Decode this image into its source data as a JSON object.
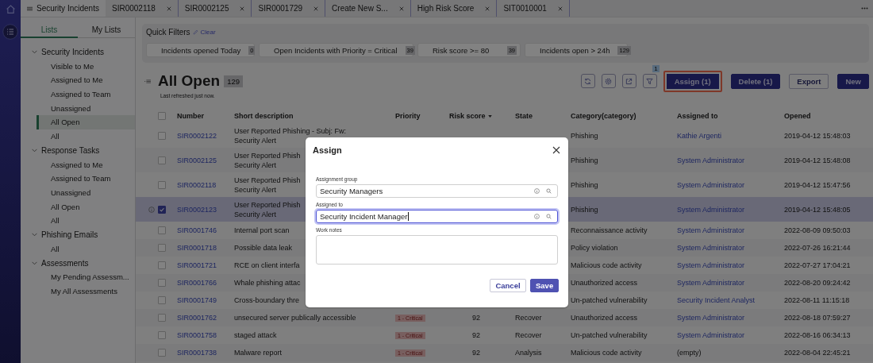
{
  "tabs": [
    {
      "label": "Security Incidents",
      "selected": true,
      "closable": false
    },
    {
      "label": "SIR0002118",
      "selected": false,
      "closable": true
    },
    {
      "label": "SIR0002125",
      "selected": false,
      "closable": true
    },
    {
      "label": "SIR0001729",
      "selected": false,
      "closable": true
    },
    {
      "label": "Create New S...",
      "selected": false,
      "closable": true
    },
    {
      "label": "High Risk Score",
      "selected": false,
      "closable": true
    },
    {
      "label": "SIT0010001",
      "selected": false,
      "closable": true
    }
  ],
  "list_tabs": [
    {
      "label": "Lists",
      "selected": true
    },
    {
      "label": "My Lists",
      "selected": false
    }
  ],
  "tree": [
    {
      "label": "Security Incidents",
      "expanded": true,
      "children": [
        {
          "label": "Visible to Me",
          "selected": false
        },
        {
          "label": "Assigned to Me",
          "selected": false
        },
        {
          "label": "Assigned to Team",
          "selected": false
        },
        {
          "label": "Unassigned",
          "selected": false
        },
        {
          "label": "All Open",
          "selected": true
        },
        {
          "label": "All",
          "selected": false
        }
      ]
    },
    {
      "label": "Response Tasks",
      "expanded": true,
      "children": [
        {
          "label": "Assigned to Me",
          "selected": false
        },
        {
          "label": "Assigned to Team",
          "selected": false
        },
        {
          "label": "Unassigned",
          "selected": false
        },
        {
          "label": "All Open",
          "selected": false
        },
        {
          "label": "All",
          "selected": false
        }
      ]
    },
    {
      "label": "Phishing Emails",
      "expanded": true,
      "children": [
        {
          "label": "All",
          "selected": false
        }
      ]
    },
    {
      "label": "Assessments",
      "expanded": true,
      "children": [
        {
          "label": "My Pending Assessm...",
          "selected": false
        },
        {
          "label": "My All Assessments",
          "selected": false
        }
      ]
    }
  ],
  "quick_filters": {
    "title": "Quick Filters",
    "clear": "Clear",
    "filters": [
      {
        "label": "Incidents opened Today",
        "count": "0"
      },
      {
        "label": "Open Incidents with Priority = Critical",
        "count": "39"
      },
      {
        "label": "Risk score >= 80",
        "count": "39"
      },
      {
        "label": "Incidents open > 24h",
        "count": "129"
      }
    ]
  },
  "list": {
    "title": "All Open",
    "count": "129",
    "refreshed": "Last refreshed just now.",
    "filter_count": "1",
    "buttons": [
      {
        "label": "Assign (1)",
        "kind": "primary",
        "highlighted": true
      },
      {
        "label": "Delete (1)",
        "kind": "primary",
        "highlighted": false
      },
      {
        "label": "Export",
        "kind": "secondary",
        "highlighted": false
      },
      {
        "label": "New",
        "kind": "primary",
        "highlighted": false
      }
    ]
  },
  "table": {
    "all_selected": false,
    "columns": [
      {
        "label": "Number",
        "sorted": false
      },
      {
        "label": "Short description",
        "sorted": false
      },
      {
        "label": "Priority",
        "sorted": false
      },
      {
        "label": "Risk score",
        "sorted": true
      },
      {
        "label": "State",
        "sorted": false
      },
      {
        "label": "Category(category)",
        "sorted": false
      },
      {
        "label": "Assigned to",
        "sorted": false
      },
      {
        "label": "Opened",
        "sorted": false
      }
    ],
    "rows": [
      {
        "selected": false,
        "number": "SIR0002122",
        "description": [
          "User Reported Phishing - Subj: Fw:",
          "Security Alert"
        ],
        "category": "Phishing",
        "assigned_to": "Kathie Argenti",
        "assigned_link": true,
        "opened": "2019-04-12 15:48:03"
      },
      {
        "selected": false,
        "number": "SIR0002125",
        "description": [
          "User Reported Phish",
          "Security Alert"
        ],
        "category": "Phishing",
        "assigned_to": "System Administrator",
        "assigned_link": true,
        "opened": "2019-04-12 15:48:08"
      },
      {
        "selected": false,
        "number": "SIR0002118",
        "description": [
          "User Reported Phish",
          "Security Alert"
        ],
        "category": "Phishing",
        "assigned_to": "System Administrator",
        "assigned_link": true,
        "opened": "2019-04-12 15:47:56"
      },
      {
        "selected": true,
        "number": "SIR0002123",
        "description": [
          "User Reported Phish",
          "Security Alert"
        ],
        "category": "Phishing",
        "assigned_to": "System Administrator",
        "assigned_link": true,
        "opened": "2019-04-12 15:48:05"
      },
      {
        "selected": false,
        "number": "SIR0001746",
        "description": [
          "Internal port scan"
        ],
        "category": "Reconnaissance activity",
        "assigned_to": "System Administrator",
        "assigned_link": true,
        "opened": "2022-08-09 09:50:03"
      },
      {
        "selected": false,
        "number": "SIR0001718",
        "description": [
          "Possible data leak"
        ],
        "category": "Policy violation",
        "assigned_to": "System Administrator",
        "assigned_link": true,
        "opened": "2022-07-26 16:21:44"
      },
      {
        "selected": false,
        "number": "SIR0001721",
        "description": [
          "RCE on client interfa"
        ],
        "category": "Malicious code activity",
        "assigned_to": "System Administrator",
        "assigned_link": true,
        "opened": "2022-07-27 17:04:21"
      },
      {
        "selected": false,
        "number": "SIR0001766",
        "description": [
          "Whale phishing attac"
        ],
        "category": "Unauthorized access",
        "assigned_to": "System Administrator",
        "assigned_link": true,
        "opened": "2022-08-20 09:24:42"
      },
      {
        "selected": false,
        "number": "SIR0001749",
        "description": [
          "Cross-boundary thre"
        ],
        "category": "Un-patched vulnerability",
        "assigned_to": "Security Incident Analyst",
        "assigned_link": true,
        "opened": "2022-08-11 11:15:18"
      },
      {
        "selected": false,
        "number": "SIR0001762",
        "description": [
          "unsecured server publically accessible"
        ],
        "priority": "1 - Critical",
        "risk_score": "92",
        "state": "Recover",
        "category": "Unauthorized access",
        "assigned_to": "System Administrator",
        "assigned_link": true,
        "opened": "2022-08-18 07:59:27"
      },
      {
        "selected": false,
        "number": "SIR0001758",
        "description": [
          "staged attack"
        ],
        "priority": "1 - Critical",
        "risk_score": "92",
        "state": "Recover",
        "category": "Un-patched vulnerability",
        "assigned_to": "System Administrator",
        "assigned_link": true,
        "opened": "2022-08-16 06:34:13"
      },
      {
        "selected": false,
        "number": "SIR0001738",
        "description": [
          "Malware report"
        ],
        "priority": "1 - Critical",
        "risk_score": "92",
        "state": "Analysis",
        "category": "Malicious code activity",
        "assigned_to": "(empty)",
        "assigned_link": false,
        "opened": "2022-08-04 22:45:21"
      }
    ]
  },
  "modal": {
    "title": "Assign",
    "fields": [
      {
        "label": "Assignment group",
        "kind": "reference",
        "value": "Security Managers",
        "focused": false
      },
      {
        "label": "Assigned to",
        "kind": "reference",
        "value": "Security Incident Manager",
        "focused": true
      },
      {
        "label": "Work notes",
        "kind": "textarea",
        "focused": false
      }
    ],
    "buttons": [
      {
        "label": "Cancel",
        "kind": "secondary"
      },
      {
        "label": "Save",
        "kind": "primary"
      }
    ]
  }
}
